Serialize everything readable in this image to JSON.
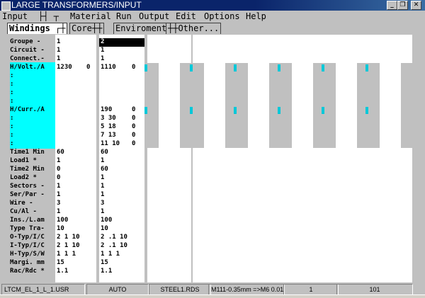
{
  "window": {
    "title": "LARGE TRANSFORMERS/INPUT",
    "buttons": {
      "minimize": "_",
      "restore": "❐",
      "close": "✕"
    }
  },
  "menu": [
    "Input",
    "├┤ ┬",
    "Material",
    "Run",
    "Output",
    "Edit",
    "Options",
    "Help"
  ],
  "tabs": [
    "Windings ┌┼",
    "Core┼┼",
    "Enviroment",
    "┼┼Other..."
  ],
  "rows": [
    {
      "label": "Groupe   -",
      "a": "1",
      "b": "",
      "c": "2",
      "d": ""
    },
    {
      "label": "Circuit  -",
      "a": "1",
      "b": "",
      "c": "1",
      "d": ""
    },
    {
      "label": "Connect.-",
      "a": "1",
      "b": "",
      "c": "1",
      "d": ""
    },
    {
      "label": "H/Volt./A",
      "a": "1230",
      "b": "0",
      "c": "1110",
      "d": "0"
    },
    {
      "label": ":",
      "a": "",
      "b": "",
      "c": "",
      "d": ""
    },
    {
      "label": ":",
      "a": "",
      "b": "",
      "c": "",
      "d": ""
    },
    {
      "label": ":",
      "a": "",
      "b": "",
      "c": "",
      "d": ""
    },
    {
      "label": ":",
      "a": "",
      "b": "",
      "c": "",
      "d": ""
    },
    {
      "label": "H/Curr./A",
      "a": "",
      "b": "",
      "c": "190",
      "d": "0"
    },
    {
      "label": ":",
      "a": "",
      "b": "",
      "c": "3   30",
      "d": "0"
    },
    {
      "label": ":",
      "a": "",
      "b": "",
      "c": "5   18",
      "d": "0"
    },
    {
      "label": ":",
      "a": "",
      "b": "",
      "c": "7   13",
      "d": "0"
    },
    {
      "label": ":",
      "a": "",
      "b": "",
      "c": "11  10",
      "d": "0"
    },
    {
      "label": "Time1 Min",
      "a": "60",
      "b": "",
      "c": "60",
      "d": ""
    },
    {
      "label": "Load1    *",
      "a": "1",
      "b": "",
      "c": "1",
      "d": ""
    },
    {
      "label": "Time2 Min",
      "a": "0",
      "b": "",
      "c": "60",
      "d": ""
    },
    {
      "label": "Load2    *",
      "a": "0",
      "b": "",
      "c": "1",
      "d": ""
    },
    {
      "label": "Sectors  -",
      "a": "1",
      "b": "",
      "c": "1",
      "d": ""
    },
    {
      "label": "Ser/Par  -",
      "a": "1",
      "b": "",
      "c": "1",
      "d": ""
    },
    {
      "label": "Wire     -",
      "a": "3",
      "b": "",
      "c": "3",
      "d": ""
    },
    {
      "label": "Cu/Al    -",
      "a": "1",
      "b": "",
      "c": "1",
      "d": ""
    },
    {
      "label": "Ins./L.am",
      "a": "100",
      "b": "",
      "c": "100",
      "d": ""
    },
    {
      "label": "Type Tra-",
      "a": "10",
      "b": "",
      "c": "10",
      "d": ""
    },
    {
      "label": "O-Typ/I/C",
      "a": "2   1   10",
      "b": "",
      "c": "2   .1   10",
      "d": ""
    },
    {
      "label": "I-Typ/I/C",
      "a": "2   1   10",
      "b": "",
      "c": "2   .1   10",
      "d": ""
    },
    {
      "label": "H-Typ/S/W",
      "a": "1   1   1",
      "b": "",
      "c": "1   1   1",
      "d": ""
    },
    {
      "label": "Margi. mm",
      "a": "15",
      "b": "",
      "c": "15",
      "d": ""
    },
    {
      "label": "Rac/Rdc  *",
      "a": "1.1",
      "b": "",
      "c": "1.1",
      "d": ""
    }
  ],
  "status": [
    "LTCM_EL_1_L_1.USR",
    "AUTO",
    "STEEL1.RDS",
    "M111-0.35mm =>M6 0.014",
    "1",
    "101"
  ],
  "colors": {
    "accent": "#0a246a",
    "cyan": "#00ffff"
  }
}
